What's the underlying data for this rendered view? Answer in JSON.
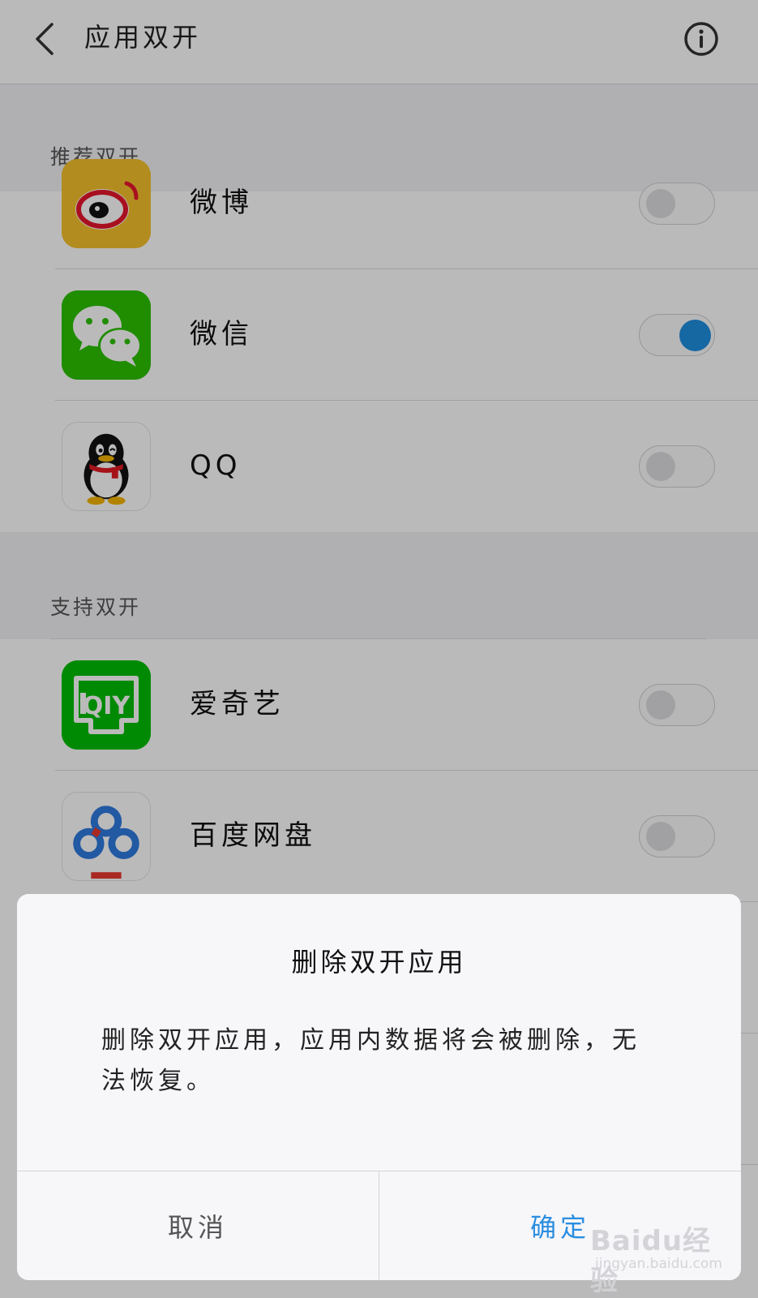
{
  "header": {
    "title": "应用双开",
    "back_icon": "back-arrow-icon",
    "info_icon": "info-icon"
  },
  "sections": {
    "recommended": {
      "label": "推荐双开",
      "apps": [
        {
          "name": "微博",
          "icon": "weibo-icon",
          "enabled": false
        },
        {
          "name": "微信",
          "icon": "wechat-icon",
          "enabled": true
        },
        {
          "name": "QQ",
          "icon": "qq-icon",
          "enabled": false
        }
      ]
    },
    "supported": {
      "label": "支持双开",
      "apps": [
        {
          "name": "爱奇艺",
          "icon": "iqiyi-icon",
          "enabled": false
        },
        {
          "name": "百度网盘",
          "icon": "baidu-netdisk-icon",
          "enabled": false
        }
      ]
    }
  },
  "dialog": {
    "title": "删除双开应用",
    "message": "删除双开应用，应用内数据将会被删除，无法恢复。",
    "cancel_label": "取消",
    "confirm_label": "确定"
  },
  "watermark": {
    "brand": "Baidu经验",
    "url": "jingyan.baidu.com"
  },
  "colors": {
    "accent": "#1f8fe0",
    "confirm_text": "#2a8ee0",
    "wechat_green": "#2dc100",
    "iqiyi_green": "#00be06",
    "weibo_yellow": "#f6c12c",
    "weibo_red": "#e6162d"
  }
}
